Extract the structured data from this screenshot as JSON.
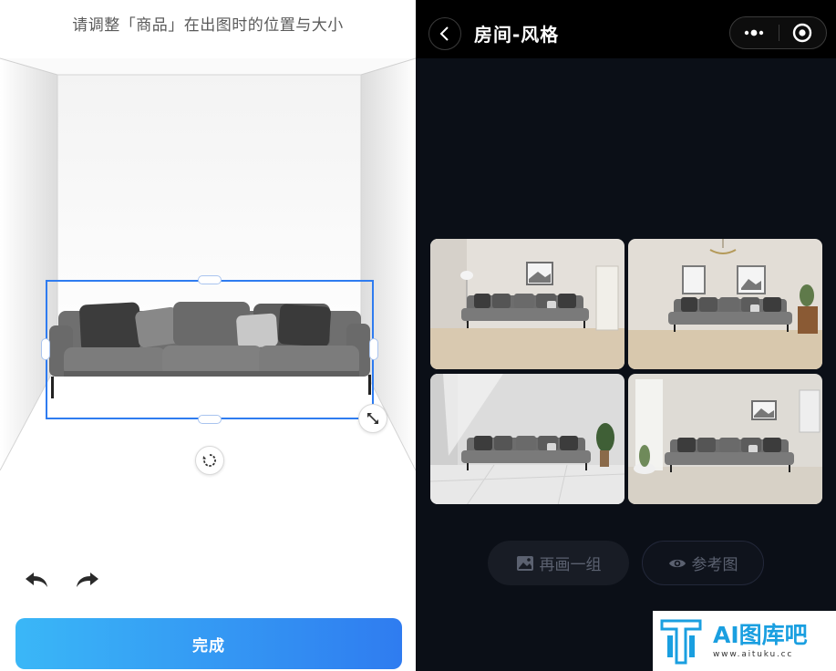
{
  "editor": {
    "instruction": "请调整「商品」在出图时的位置与大小",
    "done_label": "完成",
    "icons": {
      "undo": "undo-arrow-icon",
      "redo": "redo-arrow-icon",
      "resize": "resize-diagonal-icon",
      "rotate": "rotate-icon"
    },
    "accent_color": "#2f7cf0"
  },
  "preview": {
    "title": "房间-风格",
    "icons": {
      "back": "chevron-left-icon",
      "more": "more-dots-icon",
      "close": "target-circle-icon"
    },
    "regenerate_label": "再画一组",
    "reference_label": "参考图"
  },
  "watermark": {
    "brand": "AI图库吧",
    "url": "www.aituku.cc"
  }
}
